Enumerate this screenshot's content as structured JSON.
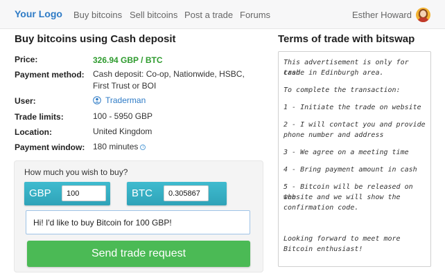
{
  "nav": {
    "logo": "Your Logo",
    "links": [
      "Buy bitcoins",
      "Sell bitcoins",
      "Post a trade",
      "Forums"
    ],
    "user_name": "Esther Howard"
  },
  "main": {
    "heading": "Buy bitcoins using Cash deposit",
    "details": {
      "price_label": "Price:",
      "price_value": "326.94 GBP / BTC",
      "payment_method_label": "Payment method:",
      "payment_method_value_line1": "Cash deposit: Co-op, Nationwide, HSBC,",
      "payment_method_value_line2": "First Trust or BOI",
      "user_label": "User:",
      "user_value": "Traderman",
      "trade_limits_label": "Trade limits:",
      "trade_limits_value": "100 - 5950 GBP",
      "location_label": "Location:",
      "location_value": "United Kingdom",
      "payment_window_label": "Payment window:",
      "payment_window_value": "180 minutes",
      "info_glyph": "i"
    },
    "buy_form": {
      "question": "How much you wish to buy?",
      "fiat_code": "GBP",
      "fiat_amount": "100",
      "crypto_code": "BTC",
      "crypto_amount": "0.305867",
      "message": "Hi! I'd like to buy Bitcoin for 100 GBP!",
      "submit_label": "Send trade request"
    }
  },
  "terms": {
    "title": "Terms of trade with bitswap",
    "lines": [
      "This advertisement is only for cash",
      "trade in Edinburgh area.",
      "To complete the transaction:",
      "1 - Initiate the trade on website",
      "2 - I will contact you and provide",
      "phone number and address",
      "3 - We agree on a meeting time",
      "4 - Bring payment amount in cash",
      "5 - Bitcoin will be released on the",
      "website and we will show the",
      "confirmation code.",
      "Looking forward to meet more",
      "Bitcoin enthusiast!"
    ]
  },
  "colors": {
    "brand": "#2e7bc6",
    "price": "#2e9b2e",
    "currency_box": "#2fa3b8",
    "send_button": "#4bba55"
  }
}
